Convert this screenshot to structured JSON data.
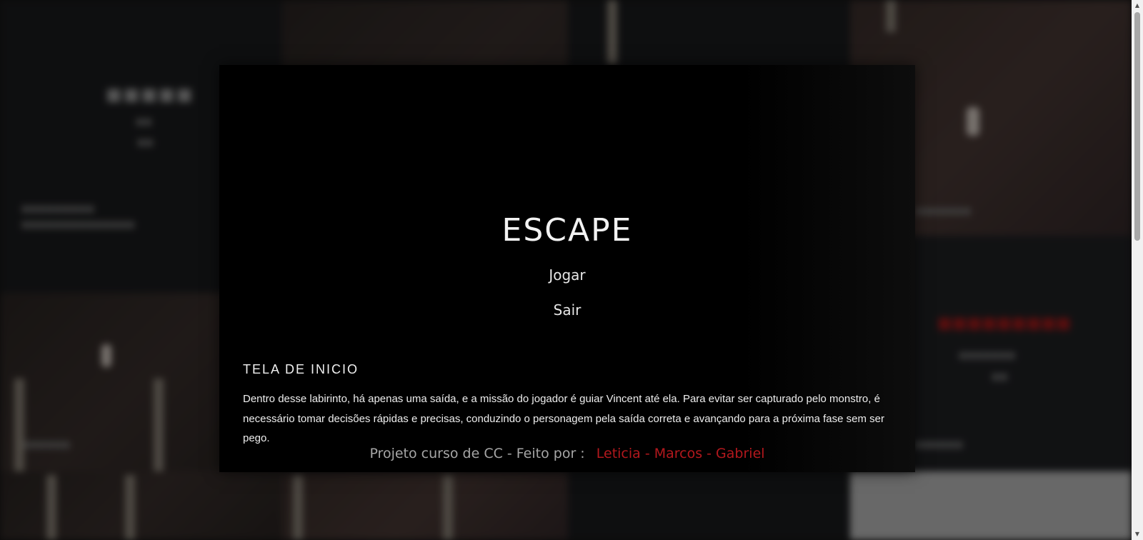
{
  "game": {
    "title": "ESCAPE",
    "menu": {
      "play_label": "Jogar",
      "exit_label": "Sair"
    }
  },
  "section": {
    "heading": "TELA DE INICIO",
    "description": "Dentro desse labirinto, há apenas uma saída, e a missão do jogador é guiar Vincent até ela. Para evitar ser capturado pelo monstro, é necessário tomar decisões rápidas e precisas, conduzindo o personagem pela saída correta e avançando para a próxima fase sem ser pego."
  },
  "credits": {
    "label": "Projeto curso de CC - Feito por :",
    "names": "Leticia - Marcos - Gabriel"
  },
  "colors": {
    "accent_red": "#b3181d",
    "modal_bg": "#000000"
  }
}
